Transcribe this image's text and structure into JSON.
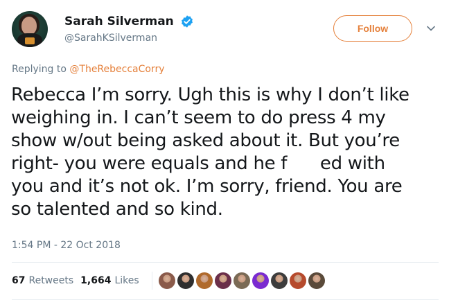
{
  "user": {
    "display_name": "Sarah Silverman",
    "handle": "@SarahKSilverman",
    "verified_icon": "verified-badge-icon"
  },
  "follow_label": "Follow",
  "reply": {
    "prefix": "Replying to",
    "mention": "@TheRebeccaCorry"
  },
  "tweet": {
    "lines": [
      "Rebecca I’m sorry. Ugh this is why I don’t like",
      "weighing in. I can’t seem to do press 4 my",
      "show w/out being asked about it.  But you’re",
      "right- you were equals and he f      ed with",
      "you and it’s not ok. I’m sorry, friend. You are",
      "so talented and so kind."
    ]
  },
  "timestamp": "1:54 PM - 22 Oct 2018",
  "stats": {
    "retweets_count": "67",
    "retweets_label": "Retweets",
    "likes_count": "1,664",
    "likes_label": "Likes"
  },
  "liker_avatars": [
    {
      "color": "#8a5a4a"
    },
    {
      "color": "#2f2f2f"
    },
    {
      "color": "#b06a2c"
    },
    {
      "color": "#6b2f4a"
    },
    {
      "color": "#7a6a55"
    },
    {
      "color": "#7a2bd0"
    },
    {
      "color": "#3d3d3d"
    },
    {
      "color": "#b64a2c"
    },
    {
      "color": "#5a4a3a"
    }
  ],
  "colors": {
    "accent": "#e5813c",
    "verified": "#1da1f2",
    "muted": "#657786"
  }
}
